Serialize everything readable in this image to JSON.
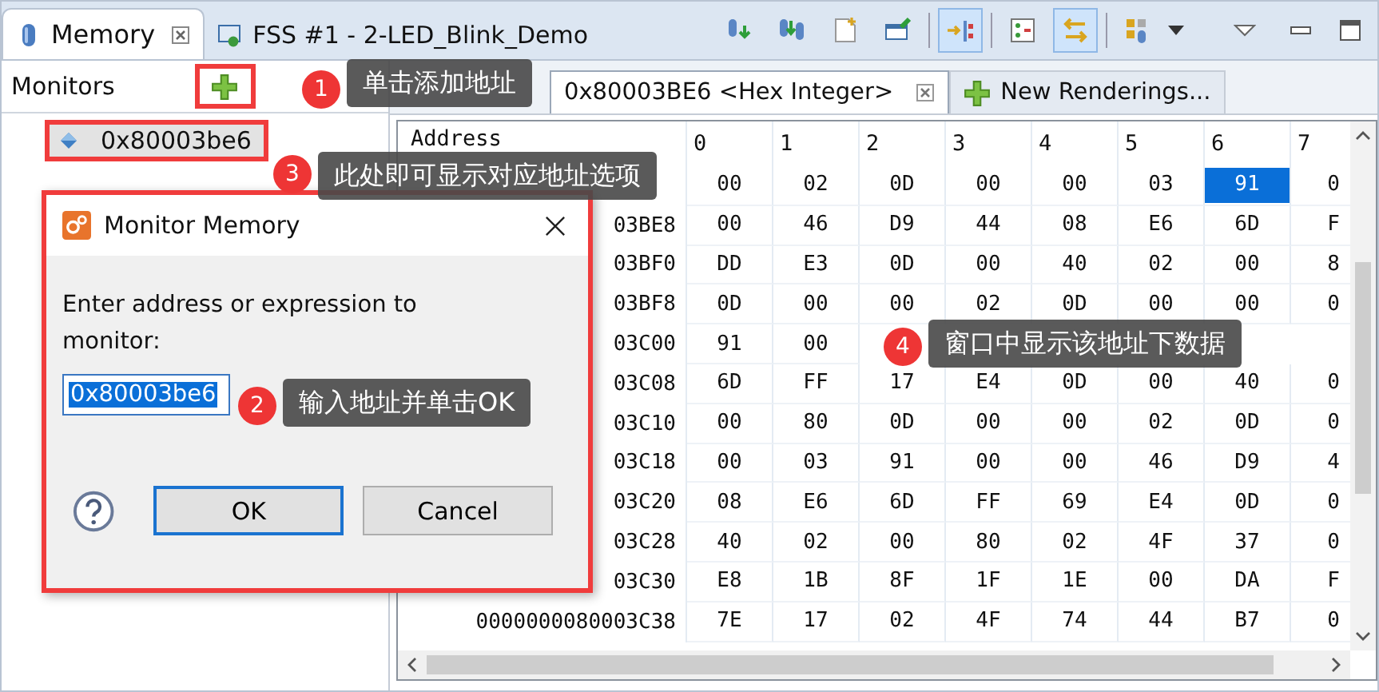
{
  "tabs": [
    {
      "label": "Memory",
      "selected": true,
      "kind": "memory"
    },
    {
      "label": "FSS #1 - 2-LED_Blink_Demo",
      "selected": false,
      "kind": "debug"
    }
  ],
  "toolbar": [
    {
      "kind": "import",
      "on": false
    },
    {
      "kind": "export",
      "on": false
    },
    {
      "kind": "new",
      "on": false
    },
    {
      "kind": "pin",
      "on": false
    },
    {
      "kind": "link",
      "on": true
    },
    {
      "kind": "columns",
      "on": false
    },
    {
      "kind": "swap",
      "on": true
    },
    {
      "kind": "layout",
      "on": false
    }
  ],
  "monitors": {
    "title": "Monitors",
    "items": [
      {
        "label": "0x80003be6",
        "selected": true
      }
    ]
  },
  "renderings": {
    "tabs": [
      {
        "label": "0x80003BE6 <Hex Integer>",
        "selected": true,
        "kind": "rendering"
      },
      {
        "label": "New Renderings...",
        "selected": false,
        "kind": "add"
      }
    ]
  },
  "table": {
    "columns": [
      "Address",
      "0",
      "1",
      "2",
      "3",
      "4",
      "5",
      "6",
      "7"
    ],
    "rows": [
      {
        "cells": [
          {
            "text": "00",
            "selected": false
          },
          {
            "text": "02",
            "selected": false
          },
          {
            "text": "0D",
            "selected": false
          },
          {
            "text": "00",
            "selected": false
          },
          {
            "text": "00",
            "selected": false
          },
          {
            "text": "03",
            "selected": false
          },
          {
            "text": "91",
            "selected": true
          },
          {
            "text": "0",
            "selected": false
          }
        ]
      },
      {
        "address": "03BE8",
        "cells": [
          {
            "text": "00",
            "selected": false
          },
          {
            "text": "46",
            "selected": false
          },
          {
            "text": "D9",
            "selected": false
          },
          {
            "text": "44",
            "selected": false
          },
          {
            "text": "08",
            "selected": false
          },
          {
            "text": "E6",
            "selected": false
          },
          {
            "text": "6D",
            "selected": false
          },
          {
            "text": "F",
            "selected": false
          }
        ]
      },
      {
        "address": "03BF0",
        "cells": [
          {
            "text": "DD",
            "selected": false
          },
          {
            "text": "E3",
            "selected": false
          },
          {
            "text": "0D",
            "selected": false
          },
          {
            "text": "00",
            "selected": false
          },
          {
            "text": "40",
            "selected": false
          },
          {
            "text": "02",
            "selected": false
          },
          {
            "text": "00",
            "selected": false
          },
          {
            "text": "8",
            "selected": false
          }
        ]
      },
      {
        "address": "03BF8",
        "cells": [
          {
            "text": "0D",
            "selected": false
          },
          {
            "text": "00",
            "selected": false
          },
          {
            "text": "00",
            "selected": false
          },
          {
            "text": "02",
            "selected": false
          },
          {
            "text": "0D",
            "selected": false
          },
          {
            "text": "00",
            "selected": false
          },
          {
            "text": "00",
            "selected": false
          },
          {
            "text": "0",
            "selected": false
          }
        ]
      },
      {
        "address": "03C00",
        "cells": [
          {
            "text": "91",
            "selected": false
          },
          {
            "text": "00",
            "selected": false
          }
        ]
      },
      {
        "address": "03C08",
        "cells": [
          {
            "text": "6D",
            "selected": false
          },
          {
            "text": "FF",
            "selected": false
          },
          {
            "text": "17",
            "selected": false
          },
          {
            "text": "E4",
            "selected": false
          },
          {
            "text": "0D",
            "selected": false
          },
          {
            "text": "00",
            "selected": false
          },
          {
            "text": "40",
            "selected": false
          },
          {
            "text": "0",
            "selected": false
          }
        ]
      },
      {
        "address": "03C10",
        "cells": [
          {
            "text": "00",
            "selected": false
          },
          {
            "text": "80",
            "selected": false
          },
          {
            "text": "0D",
            "selected": false
          },
          {
            "text": "00",
            "selected": false
          },
          {
            "text": "00",
            "selected": false
          },
          {
            "text": "02",
            "selected": false
          },
          {
            "text": "0D",
            "selected": false
          },
          {
            "text": "0",
            "selected": false
          }
        ]
      },
      {
        "address": "03C18",
        "cells": [
          {
            "text": "00",
            "selected": false
          },
          {
            "text": "03",
            "selected": false
          },
          {
            "text": "91",
            "selected": false
          },
          {
            "text": "00",
            "selected": false
          },
          {
            "text": "00",
            "selected": false
          },
          {
            "text": "46",
            "selected": false
          },
          {
            "text": "D9",
            "selected": false
          },
          {
            "text": "4",
            "selected": false
          }
        ]
      },
      {
        "address": "03C20",
        "cells": [
          {
            "text": "08",
            "selected": false
          },
          {
            "text": "E6",
            "selected": false
          },
          {
            "text": "6D",
            "selected": false
          },
          {
            "text": "FF",
            "selected": false
          },
          {
            "text": "69",
            "selected": false
          },
          {
            "text": "E4",
            "selected": false
          },
          {
            "text": "0D",
            "selected": false
          },
          {
            "text": "0",
            "selected": false
          }
        ]
      },
      {
        "address": "03C28",
        "cells": [
          {
            "text": "40",
            "selected": false
          },
          {
            "text": "02",
            "selected": false
          },
          {
            "text": "00",
            "selected": false
          },
          {
            "text": "80",
            "selected": false
          },
          {
            "text": "02",
            "selected": false
          },
          {
            "text": "4F",
            "selected": false
          },
          {
            "text": "37",
            "selected": false
          },
          {
            "text": "0",
            "selected": false
          }
        ]
      },
      {
        "address": "03C30",
        "cells": [
          {
            "text": "E8",
            "selected": false
          },
          {
            "text": "1B",
            "selected": false
          },
          {
            "text": "8F",
            "selected": false
          },
          {
            "text": "1F",
            "selected": false
          },
          {
            "text": "1E",
            "selected": false
          },
          {
            "text": "00",
            "selected": false
          },
          {
            "text": "DA",
            "selected": false
          },
          {
            "text": "F",
            "selected": false
          }
        ]
      },
      {
        "address": "0000000080003C38",
        "cells": [
          {
            "text": "7E",
            "selected": false
          },
          {
            "text": "17",
            "selected": false
          },
          {
            "text": "02",
            "selected": false
          },
          {
            "text": "4F",
            "selected": false
          },
          {
            "text": "74",
            "selected": false
          },
          {
            "text": "44",
            "selected": false
          },
          {
            "text": "B7",
            "selected": false
          },
          {
            "text": "0",
            "selected": false
          }
        ]
      }
    ]
  },
  "dialog": {
    "title": "Monitor Memory",
    "prompt": "Enter address or expression to monitor:",
    "value": "0x80003be6",
    "buttons": [
      {
        "label": "OK",
        "default": true
      },
      {
        "label": "Cancel",
        "default": false
      }
    ]
  },
  "annotations": [
    {
      "number": "1",
      "text": "单击添加地址"
    },
    {
      "number": "3",
      "text": "此处即可显示对应地址选项"
    },
    {
      "number": "2",
      "text": "输入地址并单击OK"
    },
    {
      "number": "4",
      "text": "窗口中显示该地址下数据"
    }
  ]
}
